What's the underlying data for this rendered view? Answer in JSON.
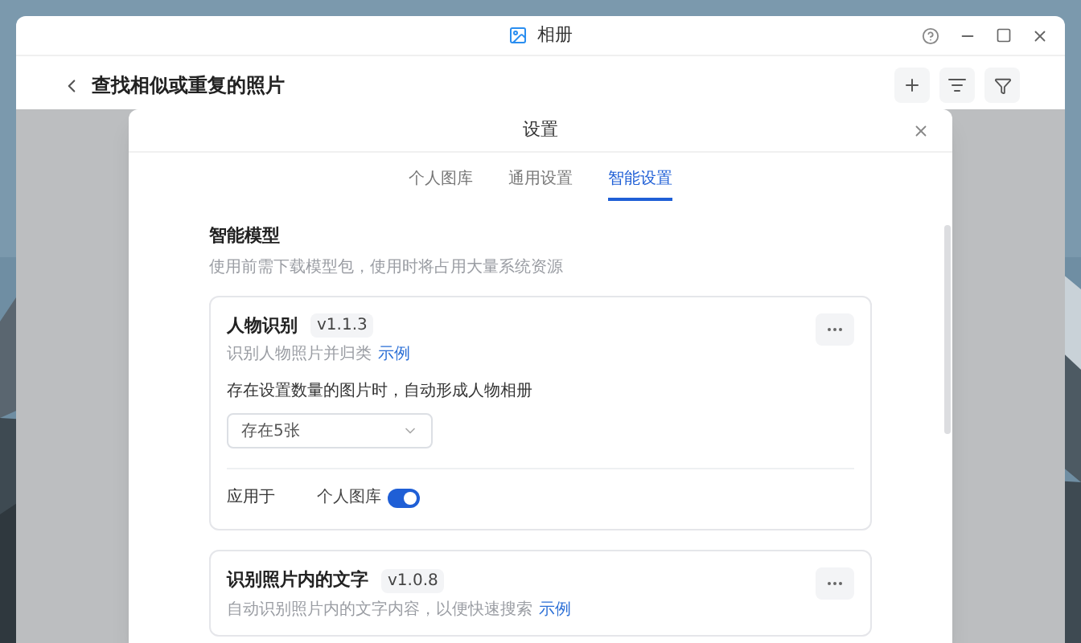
{
  "window": {
    "title": "相册"
  },
  "header": {
    "title": "查找相似或重复的照片"
  },
  "dialog": {
    "title": "设置",
    "tabs": [
      {
        "label": "个人图库",
        "selected": false
      },
      {
        "label": "通用设置",
        "selected": false
      },
      {
        "label": "智能设置",
        "selected": true
      }
    ],
    "section": {
      "title": "智能模型",
      "description": "使用前需下载模型包，使用时将占用大量系统资源"
    },
    "models": [
      {
        "name": "人物识别",
        "version": "v1.1.3",
        "description": "识别人物照片并归类",
        "link": "示例",
        "option_label": "存在设置数量的图片时，自动形成人物相册",
        "select_value": "存在5张",
        "apply_label": "应用于",
        "apply_target": "个人图库",
        "on": true
      },
      {
        "name": "识别照片内的文字",
        "version": "v1.0.8",
        "description": "自动识别照片内的文字内容，以便快速搜索",
        "link": "示例"
      }
    ]
  }
}
